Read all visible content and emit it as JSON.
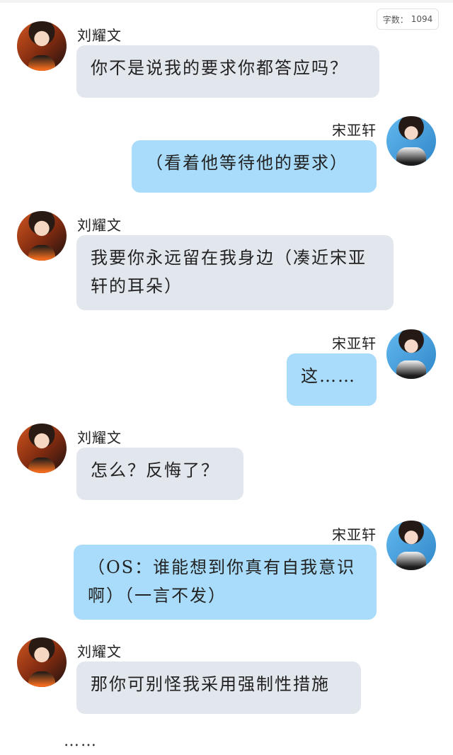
{
  "word_count": {
    "label": "字数：",
    "value": "1094"
  },
  "messages": [
    {
      "sender": "刘耀文",
      "text": "你不是说我的要求你都答应吗？"
    },
    {
      "sender": "宋亚轩",
      "text": "（看着他等待他的要求）"
    },
    {
      "sender": "刘耀文",
      "text": "我要你永远留在我身边（凑近宋亚轩的耳朵）"
    },
    {
      "sender": "宋亚轩",
      "text": "这……"
    },
    {
      "sender": "刘耀文",
      "text": "怎么？反悔了？"
    },
    {
      "sender": "宋亚轩",
      "text": "（OS：谁能想到你真有自我意识啊）（一言不发）"
    },
    {
      "sender": "刘耀文",
      "text": "那你可别怪我采用强制性措施"
    }
  ],
  "footer_ellipsis": "……"
}
